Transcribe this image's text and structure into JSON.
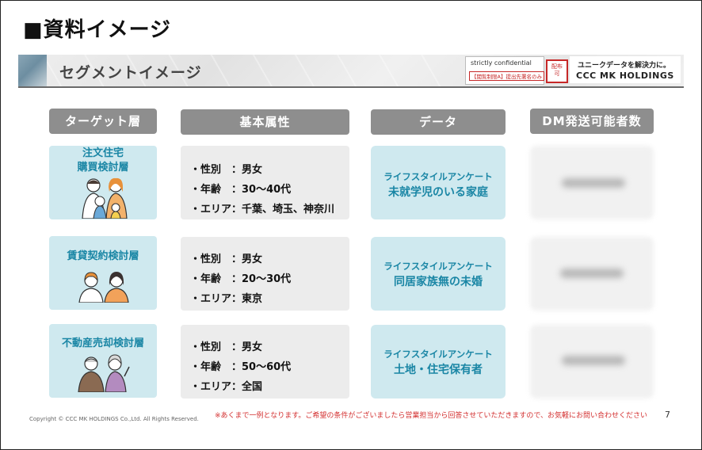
{
  "page_title": "■資料イメージ",
  "banner": {
    "title": "セグメントイメージ",
    "confidential": "strictly confidential",
    "confidential_sub": "【閲覧制限A】提出先署名のみ",
    "stamp": "配布\n可",
    "tagline": "ユニークデータを解決力に。",
    "brand": "CCC MK HOLDINGS"
  },
  "columns": [
    "ターゲット層",
    "基本属性",
    "データ",
    "DM発送可能者数"
  ],
  "rows": [
    {
      "target": "注文住宅\n購買検討層",
      "attrs": [
        "・性別　：男女",
        "・年齢　：30～40代",
        "・エリア：千葉、埼玉、神奈川"
      ],
      "data_source": "ライフスタイルアンケート",
      "data_label": "未就学児のいる家庭"
    },
    {
      "target": "賃貸契約検討層",
      "attrs": [
        "・性別　：男女",
        "・年齢　：20～30代",
        "・エリア：東京"
      ],
      "data_source": "ライフスタイルアンケート",
      "data_label": "同居家族無の未婚"
    },
    {
      "target": "不動産売却検討層",
      "attrs": [
        "・性別　：男女",
        "・年齢　：50～60代",
        "・エリア：全国"
      ],
      "data_source": "ライフスタイルアンケート",
      "data_label": "土地・住宅保有者"
    }
  ],
  "footer": {
    "copyright": "Copyright © CCC MK HOLDINGS Co.,Ltd. All Rights Reserved.",
    "note": "※あくまで一例となります。ご希望の条件がございましたら営業担当から回答させていただきますので、お気軽にお問い合わせください",
    "page_number": "7"
  },
  "colors": {
    "accent": "#1a86a5",
    "card_blue": "#cfe9ef",
    "header_gray": "#8e8e8e",
    "note_red": "#d32f2f"
  },
  "icons": [
    "family-illustration-icon",
    "couple-illustration-icon",
    "elderly-couple-illustration-icon"
  ]
}
